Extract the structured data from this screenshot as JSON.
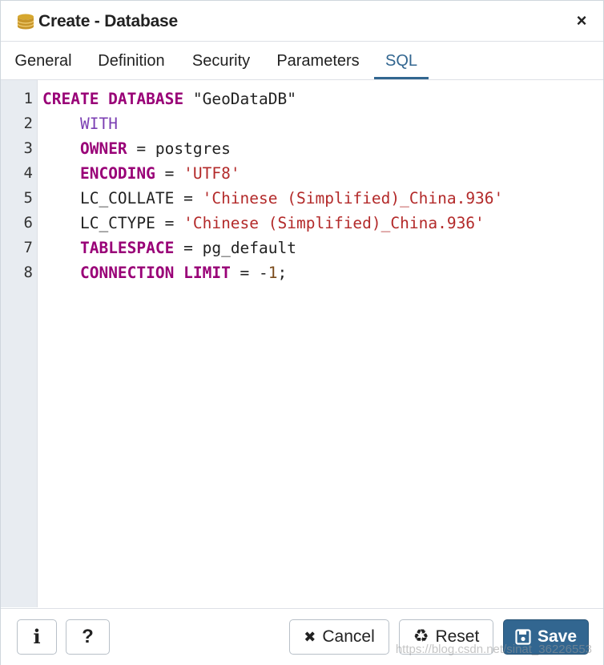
{
  "dialog": {
    "title": "Create - Database",
    "close_symbol": "×"
  },
  "tabs": [
    {
      "label": "General"
    },
    {
      "label": "Definition"
    },
    {
      "label": "Security"
    },
    {
      "label": "Parameters"
    },
    {
      "label": "SQL",
      "active": true
    }
  ],
  "editor": {
    "line_numbers": [
      "1",
      "2",
      "3",
      "4",
      "5",
      "6",
      "7",
      "8"
    ],
    "lines": [
      [
        {
          "t": "kw",
          "v": "CREATE DATABASE"
        },
        {
          "t": "",
          "v": " \"GeoDataDB\""
        }
      ],
      [
        {
          "t": "",
          "v": "    "
        },
        {
          "t": "kw2",
          "v": "WITH"
        }
      ],
      [
        {
          "t": "",
          "v": "    "
        },
        {
          "t": "kw",
          "v": "OWNER"
        },
        {
          "t": "",
          "v": " = postgres"
        }
      ],
      [
        {
          "t": "",
          "v": "    "
        },
        {
          "t": "kw",
          "v": "ENCODING"
        },
        {
          "t": "",
          "v": " = "
        },
        {
          "t": "str",
          "v": "'UTF8'"
        }
      ],
      [
        {
          "t": "",
          "v": "    LC_COLLATE = "
        },
        {
          "t": "str",
          "v": "'Chinese (Simplified)_China.936'"
        }
      ],
      [
        {
          "t": "",
          "v": "    LC_CTYPE = "
        },
        {
          "t": "str",
          "v": "'Chinese (Simplified)_China.936'"
        }
      ],
      [
        {
          "t": "",
          "v": "    "
        },
        {
          "t": "kw",
          "v": "TABLESPACE"
        },
        {
          "t": "",
          "v": " = pg_default"
        }
      ],
      [
        {
          "t": "",
          "v": "    "
        },
        {
          "t": "kw",
          "v": "CONNECTION LIMIT"
        },
        {
          "t": "",
          "v": " = -"
        },
        {
          "t": "num",
          "v": "1"
        },
        {
          "t": "",
          "v": ";"
        }
      ]
    ]
  },
  "footer": {
    "info_symbol": "i",
    "help_symbol": "?",
    "cancel_symbol": "✖",
    "cancel_label": "Cancel",
    "reset_symbol": "♻",
    "reset_label": "Reset",
    "save_label": "Save",
    "watermark": "https://blog.csdn.net/sinat_36226553"
  },
  "colors": {
    "accent": "#326690",
    "keyword": "#990077",
    "string": "#b32a2a"
  },
  "icons": {
    "title": "database-icon",
    "close": "close-icon",
    "info": "info-icon",
    "help": "help-icon",
    "cancel": "x-icon",
    "reset": "recycle-icon",
    "save": "floppy-disk-icon"
  }
}
